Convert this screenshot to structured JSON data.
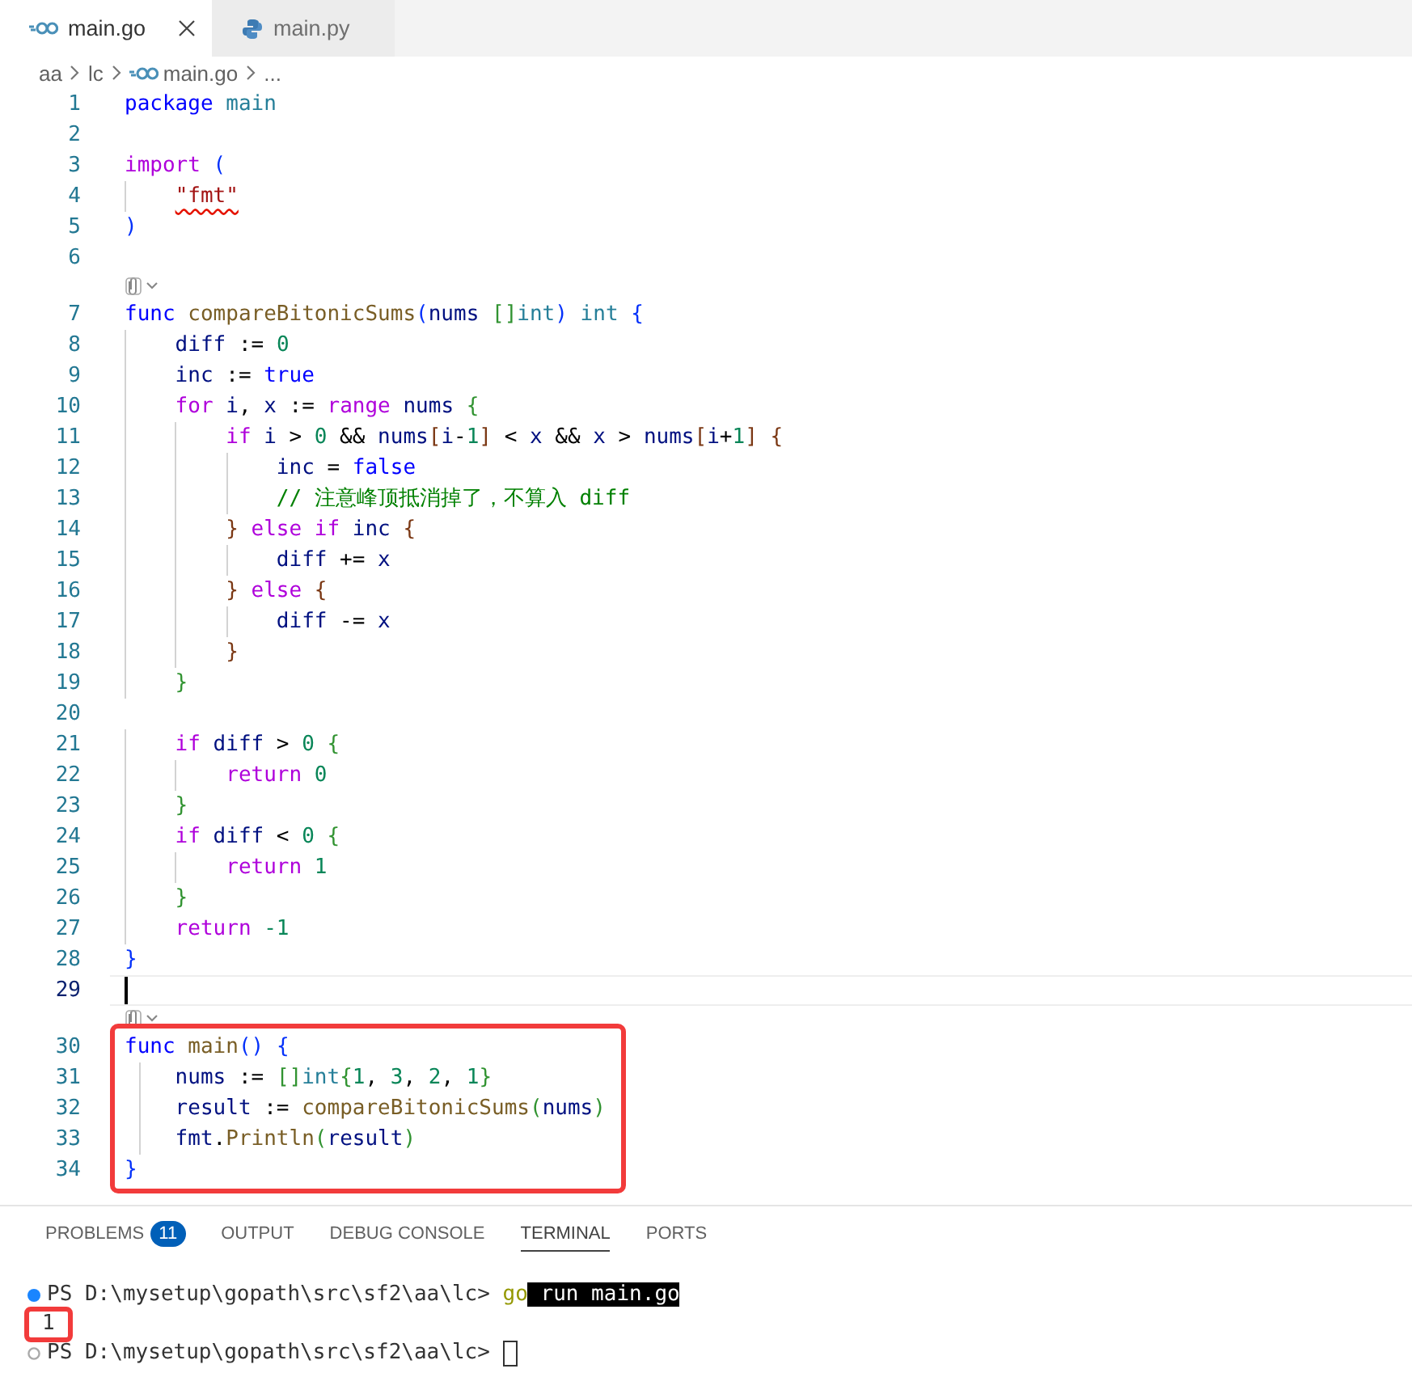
{
  "tabs": [
    {
      "label": "main.go",
      "kind": "go",
      "selected": true
    },
    {
      "label": "main.py",
      "kind": "python",
      "selected": false
    }
  ],
  "breadcrumb": [
    {
      "label": "aa",
      "kind": "folder"
    },
    {
      "label": "lc",
      "kind": "folder"
    },
    {
      "label": "main.go",
      "kind": "go"
    },
    {
      "label": "...",
      "kind": "symbol"
    }
  ],
  "editor": {
    "sections": [
      {
        "highlighted": false,
        "lines": [
          {
            "kind": "code",
            "number": "1",
            "current": false,
            "tokens": [
              {
                "text": "package ",
                "kind": "keyword"
              },
              {
                "text": "main",
                "kind": "type"
              }
            ]
          },
          {
            "kind": "code",
            "number": "2",
            "current": false
          },
          {
            "kind": "code",
            "number": "3",
            "current": false,
            "tokens": [
              {
                "text": "import ",
                "kind": "control"
              },
              {
                "text": "(",
                "kind": "bracket1"
              }
            ]
          },
          {
            "kind": "code",
            "number": "4",
            "current": false,
            "tokens": [
              {
                "text": "    \"fmt\"",
                "kind": "error-string"
              }
            ]
          },
          {
            "kind": "code",
            "number": "5",
            "current": false,
            "tokens": [
              {
                "text": ")",
                "kind": "bracket1"
              }
            ]
          },
          {
            "kind": "code",
            "number": "6",
            "current": false
          },
          {
            "kind": "codelens"
          },
          {
            "kind": "code",
            "number": "7",
            "current": false,
            "tokens": [
              {
                "text": "func ",
                "kind": "keyword"
              },
              {
                "text": "compareBitonicSums",
                "kind": "function"
              },
              {
                "text": "(",
                "kind": "bracket1"
              },
              {
                "text": "nums ",
                "kind": "variable"
              },
              {
                "text": "[]",
                "kind": "bracket2"
              },
              {
                "text": "int",
                "kind": "type"
              },
              {
                "text": ") ",
                "kind": "bracket1"
              },
              {
                "text": "int ",
                "kind": "type"
              },
              {
                "text": "{",
                "kind": "bracket1"
              }
            ]
          },
          {
            "kind": "code",
            "number": "8",
            "current": false,
            "tokens": [
              {
                "text": "    diff",
                "kind": "variable"
              },
              {
                "text": " := ",
                "kind": "plain"
              },
              {
                "text": "0",
                "kind": "number"
              }
            ]
          },
          {
            "kind": "code",
            "number": "9",
            "current": false,
            "tokens": [
              {
                "text": "    inc",
                "kind": "variable"
              },
              {
                "text": " := ",
                "kind": "plain"
              },
              {
                "text": "true",
                "kind": "keyword"
              }
            ]
          },
          {
            "kind": "code",
            "number": "10",
            "current": false,
            "tokens": [
              {
                "text": "    for ",
                "kind": "control"
              },
              {
                "text": "i",
                "kind": "variable"
              },
              {
                "text": ", ",
                "kind": "plain"
              },
              {
                "text": "x",
                "kind": "variable"
              },
              {
                "text": " := ",
                "kind": "plain"
              },
              {
                "text": "range ",
                "kind": "control"
              },
              {
                "text": "nums ",
                "kind": "variable"
              },
              {
                "text": "{",
                "kind": "bracket2"
              }
            ]
          },
          {
            "kind": "code",
            "number": "11",
            "current": false,
            "tokens": [
              {
                "text": "        if ",
                "kind": "control"
              },
              {
                "text": "i",
                "kind": "variable"
              },
              {
                "text": " > ",
                "kind": "plain"
              },
              {
                "text": "0",
                "kind": "number"
              },
              {
                "text": " && ",
                "kind": "plain"
              },
              {
                "text": "nums",
                "kind": "variable"
              },
              {
                "text": "[",
                "kind": "bracket3"
              },
              {
                "text": "i",
                "kind": "variable"
              },
              {
                "text": "-",
                "kind": "plain"
              },
              {
                "text": "1",
                "kind": "number"
              },
              {
                "text": "]",
                "kind": "bracket3"
              },
              {
                "text": " < ",
                "kind": "plain"
              },
              {
                "text": "x",
                "kind": "variable"
              },
              {
                "text": " && ",
                "kind": "plain"
              },
              {
                "text": "x",
                "kind": "variable"
              },
              {
                "text": " > ",
                "kind": "plain"
              },
              {
                "text": "nums",
                "kind": "variable"
              },
              {
                "text": "[",
                "kind": "bracket3"
              },
              {
                "text": "i",
                "kind": "variable"
              },
              {
                "text": "+",
                "kind": "plain"
              },
              {
                "text": "1",
                "kind": "number"
              },
              {
                "text": "] ",
                "kind": "bracket3"
              },
              {
                "text": "{",
                "kind": "bracket3"
              }
            ]
          },
          {
            "kind": "code",
            "number": "12",
            "current": false,
            "tokens": [
              {
                "text": "            inc",
                "kind": "variable"
              },
              {
                "text": " = ",
                "kind": "plain"
              },
              {
                "text": "false",
                "kind": "keyword"
              }
            ]
          },
          {
            "kind": "code",
            "number": "13",
            "current": false,
            "tokens": [
              {
                "text": "            // 注意峰顶抵消掉了，不算入 diff",
                "kind": "comment"
              }
            ]
          },
          {
            "kind": "code",
            "number": "14",
            "current": false,
            "tokens": [
              {
                "text": "        } ",
                "kind": "bracket3"
              },
              {
                "text": "else ",
                "kind": "control"
              },
              {
                "text": "if ",
                "kind": "control"
              },
              {
                "text": "inc ",
                "kind": "variable"
              },
              {
                "text": "{",
                "kind": "bracket3"
              }
            ]
          },
          {
            "kind": "code",
            "number": "15",
            "current": false,
            "tokens": [
              {
                "text": "            diff",
                "kind": "variable"
              },
              {
                "text": " += ",
                "kind": "plain"
              },
              {
                "text": "x",
                "kind": "variable"
              }
            ]
          },
          {
            "kind": "code",
            "number": "16",
            "current": false,
            "tokens": [
              {
                "text": "        } ",
                "kind": "bracket3"
              },
              {
                "text": "else ",
                "kind": "control"
              },
              {
                "text": "{",
                "kind": "bracket3"
              }
            ]
          },
          {
            "kind": "code",
            "number": "17",
            "current": false,
            "tokens": [
              {
                "text": "            diff",
                "kind": "variable"
              },
              {
                "text": " -= ",
                "kind": "plain"
              },
              {
                "text": "x",
                "kind": "variable"
              }
            ]
          },
          {
            "kind": "code",
            "number": "18",
            "current": false,
            "tokens": [
              {
                "text": "        }",
                "kind": "bracket3"
              }
            ]
          },
          {
            "kind": "code",
            "number": "19",
            "current": false,
            "tokens": [
              {
                "text": "    }",
                "kind": "bracket2"
              }
            ]
          },
          {
            "kind": "code",
            "number": "20",
            "current": false
          },
          {
            "kind": "code",
            "number": "21",
            "current": false,
            "tokens": [
              {
                "text": "    if ",
                "kind": "control"
              },
              {
                "text": "diff",
                "kind": "variable"
              },
              {
                "text": " > ",
                "kind": "plain"
              },
              {
                "text": "0 ",
                "kind": "number"
              },
              {
                "text": "{",
                "kind": "bracket2"
              }
            ]
          },
          {
            "kind": "code",
            "number": "22",
            "current": false,
            "tokens": [
              {
                "text": "        return ",
                "kind": "control"
              },
              {
                "text": "0",
                "kind": "number"
              }
            ]
          },
          {
            "kind": "code",
            "number": "23",
            "current": false,
            "tokens": [
              {
                "text": "    }",
                "kind": "bracket2"
              }
            ]
          },
          {
            "kind": "code",
            "number": "24",
            "current": false,
            "tokens": [
              {
                "text": "    if ",
                "kind": "control"
              },
              {
                "text": "diff",
                "kind": "variable"
              },
              {
                "text": " < ",
                "kind": "plain"
              },
              {
                "text": "0 ",
                "kind": "number"
              },
              {
                "text": "{",
                "kind": "bracket2"
              }
            ]
          },
          {
            "kind": "code",
            "number": "25",
            "current": false,
            "tokens": [
              {
                "text": "        return ",
                "kind": "control"
              },
              {
                "text": "1",
                "kind": "number"
              }
            ]
          },
          {
            "kind": "code",
            "number": "26",
            "current": false,
            "tokens": [
              {
                "text": "    }",
                "kind": "bracket2"
              }
            ]
          },
          {
            "kind": "code",
            "number": "27",
            "current": false,
            "tokens": [
              {
                "text": "    return ",
                "kind": "control"
              },
              {
                "text": "-1",
                "kind": "number"
              }
            ]
          },
          {
            "kind": "code",
            "number": "28",
            "current": false,
            "tokens": [
              {
                "text": "}",
                "kind": "bracket1"
              }
            ]
          },
          {
            "kind": "code",
            "number": "29",
            "current": true
          },
          {
            "kind": "codelens"
          }
        ]
      },
      {
        "highlighted": true,
        "lines": [
          {
            "kind": "code",
            "number": "30",
            "current": false,
            "tokens": [
              {
                "text": "func ",
                "kind": "keyword"
              },
              {
                "text": "main",
                "kind": "function"
              },
              {
                "text": "() ",
                "kind": "bracket1"
              },
              {
                "text": "{",
                "kind": "bracket1"
              }
            ]
          },
          {
            "kind": "code",
            "number": "31",
            "current": false,
            "tokens": [
              {
                "text": "    nums",
                "kind": "variable"
              },
              {
                "text": " := ",
                "kind": "plain"
              },
              {
                "text": "[]",
                "kind": "bracket2"
              },
              {
                "text": "int",
                "kind": "type"
              },
              {
                "text": "{",
                "kind": "bracket2"
              },
              {
                "text": "1",
                "kind": "number"
              },
              {
                "text": ", ",
                "kind": "plain"
              },
              {
                "text": "3",
                "kind": "number"
              },
              {
                "text": ", ",
                "kind": "plain"
              },
              {
                "text": "2",
                "kind": "number"
              },
              {
                "text": ", ",
                "kind": "plain"
              },
              {
                "text": "1",
                "kind": "number"
              },
              {
                "text": "}",
                "kind": "bracket2"
              }
            ]
          },
          {
            "kind": "code",
            "number": "32",
            "current": false,
            "tokens": [
              {
                "text": "    result",
                "kind": "variable"
              },
              {
                "text": " := ",
                "kind": "plain"
              },
              {
                "text": "compareBitonicSums",
                "kind": "function"
              },
              {
                "text": "(",
                "kind": "bracket2"
              },
              {
                "text": "nums",
                "kind": "variable"
              },
              {
                "text": ")",
                "kind": "bracket2"
              }
            ]
          },
          {
            "kind": "code",
            "number": "33",
            "current": false,
            "tokens": [
              {
                "text": "    fmt",
                "kind": "variable"
              },
              {
                "text": ".",
                "kind": "plain"
              },
              {
                "text": "Println",
                "kind": "function"
              },
              {
                "text": "(",
                "kind": "bracket2"
              },
              {
                "text": "result",
                "kind": "variable"
              },
              {
                "text": ")",
                "kind": "bracket2"
              }
            ]
          },
          {
            "kind": "code",
            "number": "34",
            "current": false,
            "tokens": [
              {
                "text": "}",
                "kind": "bracket1"
              }
            ]
          }
        ]
      }
    ]
  },
  "panel": {
    "tabs": [
      {
        "label": "PROBLEMS",
        "badge": "11",
        "selected": false
      },
      {
        "label": "OUTPUT",
        "selected": false
      },
      {
        "label": "DEBUG CONSOLE",
        "selected": false
      },
      {
        "label": "TERMINAL",
        "selected": true
      },
      {
        "label": "PORTS",
        "selected": false
      }
    ],
    "terminal": [
      {
        "kind": "executed",
        "boxed": false,
        "cursor": false,
        "segments": [
          {
            "text": "PS D:\\mysetup\\gopath\\src\\sf2\\aa\\lc> ",
            "kind": "prompt"
          },
          {
            "text": "go",
            "kind": "command"
          },
          {
            "text": " run main.go",
            "kind": "selected"
          }
        ]
      },
      {
        "kind": "output",
        "boxed": true,
        "cursor": false,
        "segments": [
          {
            "text": "1",
            "kind": "output"
          }
        ]
      },
      {
        "kind": "prompt",
        "boxed": false,
        "cursor": true,
        "segments": [
          {
            "text": "PS D:\\mysetup\\gopath\\src\\sf2\\aa\\lc> ",
            "kind": "prompt"
          }
        ]
      }
    ]
  }
}
